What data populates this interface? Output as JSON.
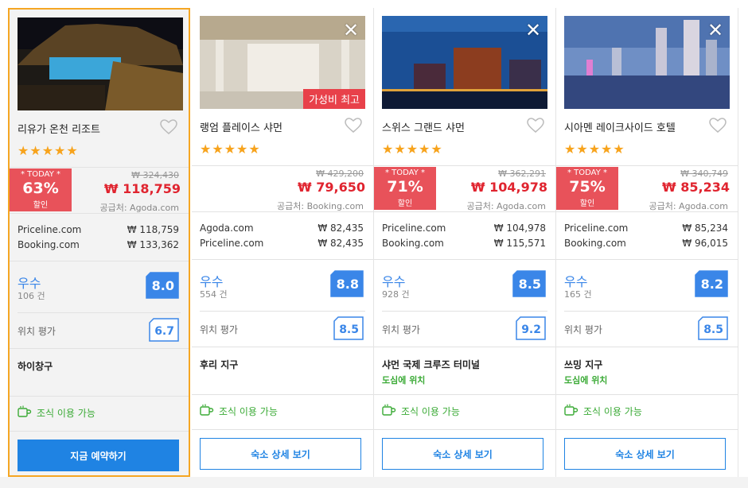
{
  "colors": {
    "accent": "#1f83e3",
    "deal": "#e8525a",
    "price": "#e0242f",
    "star": "#f7a31c",
    "good": "#3aaa35",
    "select": "#f5a623"
  },
  "common": {
    "today_label": "* TODAY *",
    "discount_word": "할인",
    "location_label": "위치 평가",
    "breakfast": "조식 이용 가능",
    "close_icon": "close-icon",
    "heart_icon": "heart-outline-icon",
    "cup_icon": "coffee-cup-icon",
    "star_char": "★★★★★"
  },
  "hotels": [
    {
      "name": "리유가 온천 리조트",
      "stars": 5,
      "today": true,
      "discount": "63%",
      "old_price": "₩ 324,430",
      "price": "₩ 118,759",
      "supplier": "공급처: Agoda.com",
      "vendors": [
        {
          "name": "Priceline.com",
          "price": "₩  118,759"
        },
        {
          "name": "Booking.com",
          "price": "₩  133,362"
        }
      ],
      "rating_word": "우수",
      "reviews": "106 건",
      "score": "8.0",
      "location_score": "6.7",
      "area": "하이창구",
      "center_note": "",
      "cta": "지금 예약하기",
      "has_close": false,
      "badge": ""
    },
    {
      "name": "랭엄 플레이스 샤먼",
      "stars": 5,
      "today": false,
      "discount": "",
      "old_price": "₩ 429,200",
      "price": "₩ 79,650",
      "supplier": "공급처: Booking.com",
      "vendors": [
        {
          "name": "Agoda.com",
          "price": "₩  82,435"
        },
        {
          "name": "Priceline.com",
          "price": "₩  82,435"
        }
      ],
      "rating_word": "우수",
      "reviews": "554 건",
      "score": "8.8",
      "location_score": "8.5",
      "area": "후리 지구",
      "center_note": "",
      "cta": "숙소 상세 보기",
      "has_close": true,
      "badge": "가성비 최고"
    },
    {
      "name": "스위스 그랜드 샤먼",
      "stars": 5,
      "today": true,
      "discount": "71%",
      "old_price": "₩ 362,291",
      "price": "₩ 104,978",
      "supplier": "공급처: Agoda.com",
      "vendors": [
        {
          "name": "Priceline.com",
          "price": "₩  104,978"
        },
        {
          "name": "Booking.com",
          "price": "₩  115,571"
        }
      ],
      "rating_word": "우수",
      "reviews": "928 건",
      "score": "8.5",
      "location_score": "9.2",
      "area": "샤먼 국제 크루즈 터미널",
      "center_note": "도심에 위치",
      "cta": "숙소 상세 보기",
      "has_close": true,
      "badge": ""
    },
    {
      "name": "시아멘 레이크사이드 호텔",
      "stars": 5,
      "today": true,
      "discount": "75%",
      "old_price": "₩ 340,749",
      "price": "₩ 85,234",
      "supplier": "공급처: Agoda.com",
      "vendors": [
        {
          "name": "Priceline.com",
          "price": "₩  85,234"
        },
        {
          "name": "Booking.com",
          "price": "₩  96,015"
        }
      ],
      "rating_word": "우수",
      "reviews": "165 건",
      "score": "8.2",
      "location_score": "8.5",
      "area": "쓰밍 지구",
      "center_note": "도심에 위치",
      "cta": "숙소 상세 보기",
      "has_close": true,
      "badge": ""
    }
  ]
}
